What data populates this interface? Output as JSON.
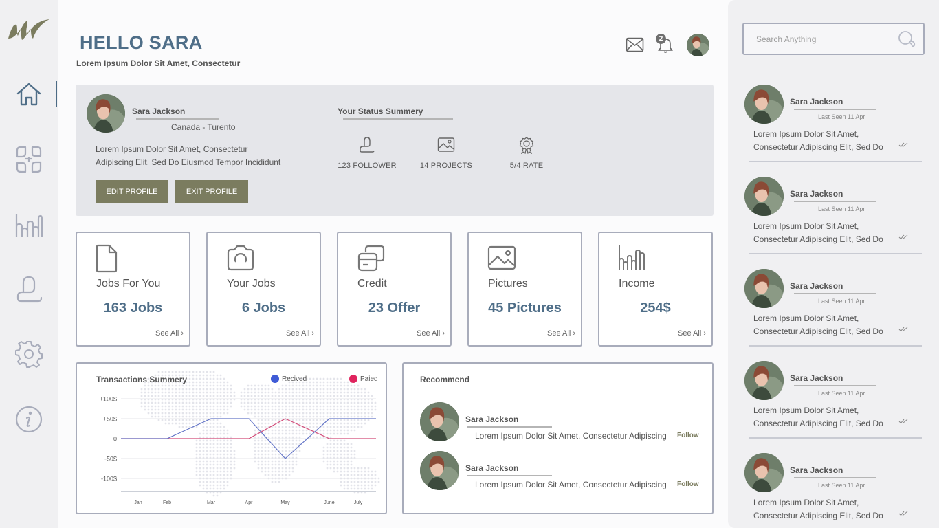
{
  "header": {
    "greeting": "HELLO SARA",
    "subtitle": "Lorem Ipsum Dolor Sit Amet, Consectetur",
    "notification_count": "2"
  },
  "sidebar": {
    "items": [
      {
        "icon": "home-icon",
        "active": true
      },
      {
        "icon": "dashboard-icon",
        "active": false
      },
      {
        "icon": "stats-icon",
        "active": false
      },
      {
        "icon": "user-icon",
        "active": false
      },
      {
        "icon": "settings-icon",
        "active": false
      },
      {
        "icon": "info-icon",
        "active": false
      }
    ]
  },
  "profile": {
    "name": "Sara Jackson",
    "location": "Canada - Turento",
    "bio_line1": "Lorem Ipsum Dolor Sit Amet, Consectetur",
    "bio_line2": "Adipiscing Elit, Sed Do Eiusmod Tempor Incididunt",
    "edit_label": "EDIT PROFILE",
    "exit_label": "EXIT PROFILE",
    "status_title": "Your Status Summery",
    "stats": [
      {
        "icon": "follower-icon",
        "label": "123 FOLLOWER"
      },
      {
        "icon": "projects-icon",
        "label": "14 PROJECTS"
      },
      {
        "icon": "rate-icon",
        "label": "5/4 RATE"
      }
    ]
  },
  "cards": [
    {
      "icon": "document-icon",
      "title": "Jobs For You",
      "value": "163 Jobs",
      "see_all": "See All"
    },
    {
      "icon": "camera-icon",
      "title": "Your Jobs",
      "value": "6 Jobs",
      "see_all": "See All"
    },
    {
      "icon": "credit-card-icon",
      "title": "Credit",
      "value": "23 Offer",
      "see_all": "See All"
    },
    {
      "icon": "picture-icon",
      "title": "Pictures",
      "value": "45 Pictures",
      "see_all": "See All"
    },
    {
      "icon": "income-icon",
      "title": "Income",
      "value": "254$",
      "see_all": "See All"
    }
  ],
  "chart_data": {
    "type": "line",
    "title": "Transactions Summery",
    "x": [
      "Jan",
      "Feb",
      "Mar",
      "Apr",
      "May",
      "June",
      "July"
    ],
    "y_ticks": [
      "+100$",
      "+50$",
      "0",
      "-50$",
      "-100$"
    ],
    "ylim": [
      -100,
      100
    ],
    "legend_position": "top-right",
    "series": [
      {
        "name": "Recived",
        "color": "#3f5bd6",
        "line_color": "#6677c8",
        "points": [
          [
            "Jan",
            0
          ],
          [
            "Feb",
            0
          ],
          [
            "Mar",
            50
          ],
          [
            "Apr",
            50
          ],
          [
            "May",
            -50
          ],
          [
            "June",
            50
          ],
          [
            "July",
            50
          ]
        ]
      },
      {
        "name": "Paied",
        "color": "#e0245e",
        "line_color": "#d24a78",
        "points": [
          [
            "Jan",
            0
          ],
          [
            "Feb",
            0
          ],
          [
            "Mar",
            0
          ],
          [
            "Apr",
            0
          ],
          [
            "May",
            50
          ],
          [
            "June",
            0
          ],
          [
            "July",
            0
          ]
        ]
      }
    ]
  },
  "recommend": {
    "title": "Recommend",
    "items": [
      {
        "name": "Sara Jackson",
        "text": "Lorem Ipsum Dolor Sit Amet, Consectetur Adipiscing",
        "follow": "Follow"
      },
      {
        "name": "Sara Jackson",
        "text": "Lorem Ipsum Dolor Sit Amet, Consectetur Adipiscing",
        "follow": "Follow"
      }
    ]
  },
  "search": {
    "placeholder": "Search Anything"
  },
  "messages": [
    {
      "name": "Sara Jackson",
      "seen": "Last Seen 11 Apr",
      "line1": "Lorem Ipsum Dolor Sit Amet,",
      "line2": "Consectetur Adipiscing Elit, Sed Do"
    },
    {
      "name": "Sara Jackson",
      "seen": "Last Seen 11 Apr",
      "line1": "Lorem Ipsum Dolor Sit Amet,",
      "line2": "Consectetur Adipiscing Elit, Sed Do"
    },
    {
      "name": "Sara Jackson",
      "seen": "Last Seen 11 Apr",
      "line1": "Lorem Ipsum Dolor Sit Amet,",
      "line2": "Consectetur Adipiscing Elit, Sed Do"
    },
    {
      "name": "Sara Jackson",
      "seen": "Last Seen 11 Apr",
      "line1": "Lorem Ipsum Dolor Sit Amet,",
      "line2": "Consectetur Adipiscing Elit, Sed Do"
    },
    {
      "name": "Sara Jackson",
      "seen": "Last Seen 11 Apr",
      "line1": "Lorem Ipsum Dolor Sit Amet,",
      "line2": "Consectetur Adipiscing Elit, Sed Do"
    }
  ],
  "colors": {
    "accent": "#4f6e88",
    "button": "#7b7c5f",
    "panel": "#e5e6ea",
    "border": "#a8acbb"
  }
}
